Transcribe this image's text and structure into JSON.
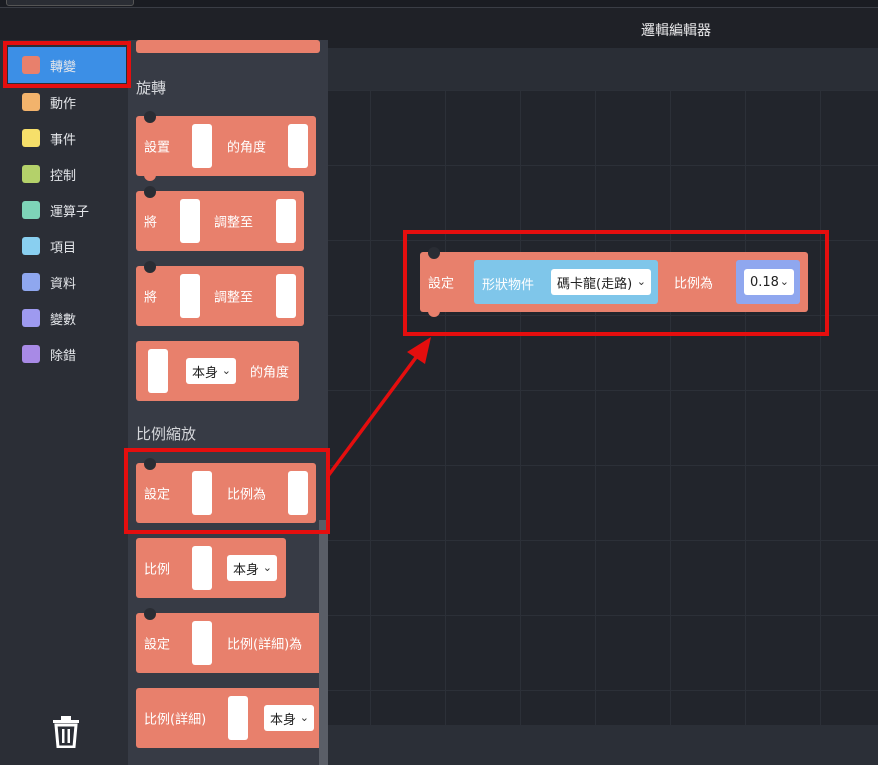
{
  "window": {
    "title": "邏輯編輯器"
  },
  "categories": [
    {
      "label": "轉變",
      "color": "#e8806c",
      "active": true
    },
    {
      "label": "動作",
      "color": "#f2b36c"
    },
    {
      "label": "事件",
      "color": "#f6df6a"
    },
    {
      "label": "控制",
      "color": "#b4d16a"
    },
    {
      "label": "運算子",
      "color": "#7ed4b8"
    },
    {
      "label": "項目",
      "color": "#89cff0"
    },
    {
      "label": "資料",
      "color": "#8fa7ef"
    },
    {
      "label": "變數",
      "color": "#9e9af0"
    },
    {
      "label": "除錯",
      "color": "#a88ae6"
    }
  ],
  "flyout": {
    "rotation_title": "旋轉",
    "scale_title": "比例縮放",
    "blocks": {
      "set_angle": {
        "a": "設置",
        "b": "的角度"
      },
      "adjust1": {
        "a": "將",
        "b": "調整至"
      },
      "adjust2": {
        "a": "將",
        "b": "調整至"
      },
      "angle_of": {
        "select": "本身",
        "b": "的角度"
      },
      "set_scale": {
        "a": "設定",
        "b": "比例為"
      },
      "scale_of": {
        "a": "比例",
        "select": "本身"
      },
      "set_scale_detail": {
        "a": "設定",
        "b": "比例(詳細)為"
      },
      "scale_detail_of": {
        "a": "比例(詳細)",
        "select": "本身"
      }
    }
  },
  "workspace_block": {
    "set": "設定",
    "object_type": "形狀物件",
    "object_select": "碼卡龍(走路)",
    "scale_label": "比例為",
    "scale_value": "0.18"
  }
}
